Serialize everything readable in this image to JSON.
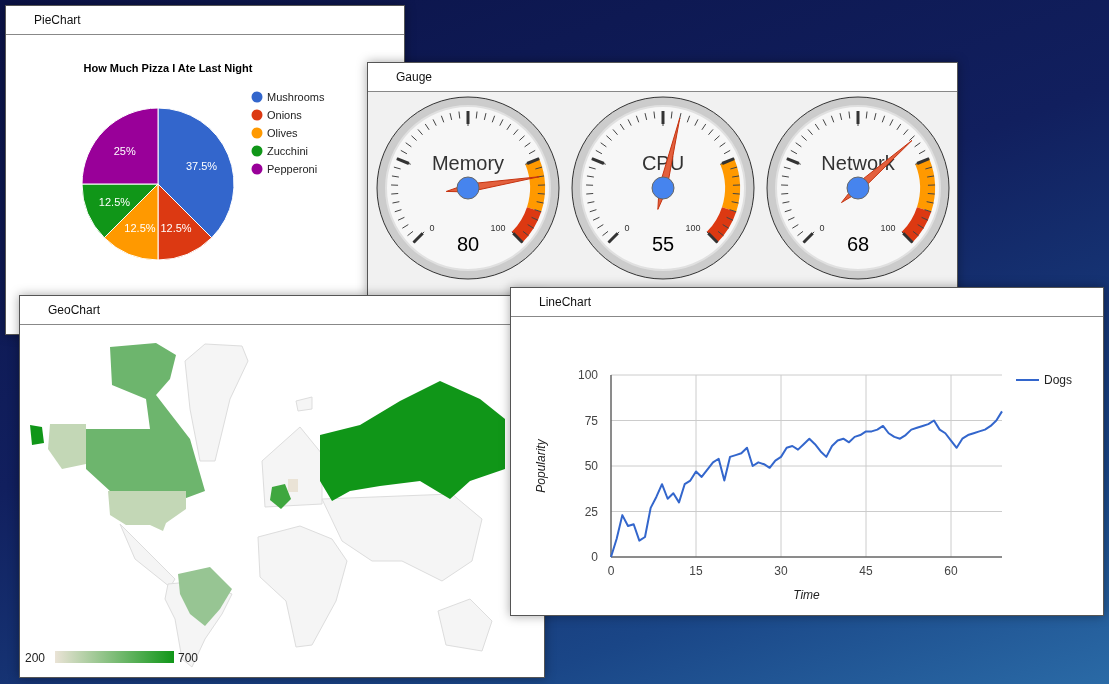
{
  "windows": [
    {
      "kind": "pie",
      "title": "PieChart",
      "chart_data": {
        "type": "pie",
        "title": "How Much Pizza I Ate Last Night",
        "categories": [
          "Mushrooms",
          "Onions",
          "Olives",
          "Zucchini",
          "Pepperoni"
        ],
        "values": [
          37.5,
          12.5,
          12.5,
          12.5,
          25
        ],
        "value_labels": [
          "37.5%",
          "12.5%",
          "12.5%",
          "12.5%",
          "25%"
        ],
        "legend": true,
        "colors": [
          "#3366cc",
          "#dc3912",
          "#ff9900",
          "#109618",
          "#990099"
        ]
      }
    },
    {
      "kind": "gauge",
      "title": "Gauge",
      "gauges": [
        {
          "label": "Memory",
          "value": "80",
          "level": 0.8,
          "min_label": "0",
          "max_label": "100"
        },
        {
          "label": "CPU",
          "value": "55",
          "level": 0.55,
          "min_label": "0",
          "max_label": "100"
        },
        {
          "label": "Network",
          "value": "68",
          "level": 0.68,
          "min_label": "0",
          "max_label": "100"
        }
      ]
    },
    {
      "kind": "geo",
      "title": "GeoChart",
      "legend": {
        "min": "200",
        "max": "700"
      }
    },
    {
      "kind": "line",
      "title": "LineChart",
      "chart_data": {
        "type": "line",
        "xlabel": "Time",
        "ylabel": "Popularity",
        "x": [
          0,
          1,
          2,
          3,
          4,
          5,
          6,
          7,
          8,
          9,
          10,
          11,
          12,
          13,
          14,
          15,
          16,
          17,
          18,
          19,
          20,
          21,
          22,
          23,
          24,
          25,
          26,
          27,
          28,
          29,
          30,
          31,
          32,
          33,
          34,
          35,
          36,
          37,
          38,
          39,
          40,
          41,
          42,
          43,
          44,
          45,
          46,
          47,
          48,
          49,
          50,
          51,
          52,
          53,
          54,
          55,
          56,
          57,
          58,
          59,
          60,
          61,
          62,
          63,
          64,
          65,
          66,
          67,
          68,
          69
        ],
        "series": [
          {
            "name": "Dogs",
            "color": "#3366cc",
            "values": [
              0,
              10,
              23,
              17,
              18,
              9,
              11,
              27,
              33,
              40,
              32,
              35,
              30,
              40,
              42,
              47,
              44,
              48,
              52,
              54,
              42,
              55,
              56,
              57,
              60,
              50,
              52,
              51,
              49,
              53,
              55,
              60,
              61,
              59,
              62,
              65,
              62,
              58,
              55,
              61,
              64,
              65,
              63,
              66,
              67,
              69,
              69,
              70,
              72,
              68,
              66,
              65,
              67,
              70,
              71,
              72,
              73,
              75,
              70,
              68,
              64,
              60,
              65,
              67,
              68,
              69,
              70,
              72,
              75,
              80
            ]
          }
        ],
        "grid": true,
        "legend": true,
        "xlim": [
          0,
          69
        ],
        "ylim": [
          0,
          100
        ],
        "xticks": [
          {
            "value": 0,
            "label": "0"
          },
          {
            "value": 15,
            "label": "15"
          },
          {
            "value": 30,
            "label": "30"
          },
          {
            "value": 45,
            "label": "45"
          },
          {
            "value": 60,
            "label": "60"
          }
        ],
        "yticks": [
          {
            "value": 0,
            "label": "0"
          },
          {
            "value": 25,
            "label": "25"
          },
          {
            "value": 50,
            "label": "50"
          },
          {
            "value": 75,
            "label": "75"
          },
          {
            "value": 100,
            "label": "100"
          }
        ]
      }
    }
  ]
}
